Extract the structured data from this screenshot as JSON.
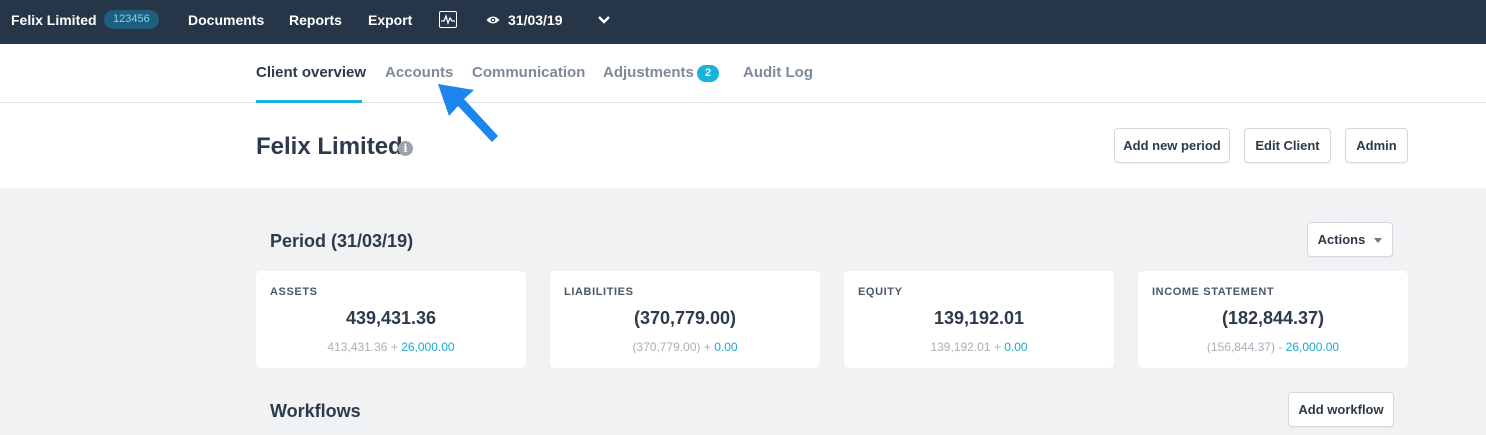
{
  "topbar": {
    "client_name": "Felix Limited",
    "client_id": "123456",
    "nav": [
      "Documents",
      "Reports",
      "Export"
    ],
    "period_date": "31/03/19"
  },
  "tabs": {
    "items": [
      "Client overview",
      "Accounts",
      "Communication",
      "Adjustments",
      "Audit Log"
    ],
    "active": "Client overview",
    "adjustments_count": "2"
  },
  "header": {
    "title": "Felix Limited",
    "info_glyph": "i",
    "buttons": {
      "add_period": "Add new period",
      "edit_client": "Edit Client",
      "admin": "Admin"
    }
  },
  "period": {
    "title": "Period (31/03/19)",
    "actions_label": "Actions",
    "cards": [
      {
        "label": "ASSETS",
        "value": "439,431.36",
        "base": "413,431.36",
        "op": "+",
        "adjustment": "26,000.00"
      },
      {
        "label": "LIABILITIES",
        "value": "(370,779.00)",
        "base": "(370,779.00)",
        "op": "+",
        "adjustment": "0.00"
      },
      {
        "label": "EQUITY",
        "value": "139,192.01",
        "base": "139,192.01",
        "op": "+",
        "adjustment": "0.00"
      },
      {
        "label": "INCOME STATEMENT",
        "value": "(182,844.37)",
        "base": "(156,844.37)",
        "op": "-",
        "adjustment": "26,000.00"
      }
    ]
  },
  "workflows": {
    "title": "Workflows",
    "add_label": "Add workflow"
  },
  "colors": {
    "topbar_bg": "#273549",
    "accent": "#19b2da",
    "page_bg": "#f1f2f4"
  },
  "icons": [
    "chart-icon",
    "eye-icon",
    "chevron-down-icon",
    "info-icon",
    "caret-down-icon",
    "pointer-arrow-icon"
  ]
}
